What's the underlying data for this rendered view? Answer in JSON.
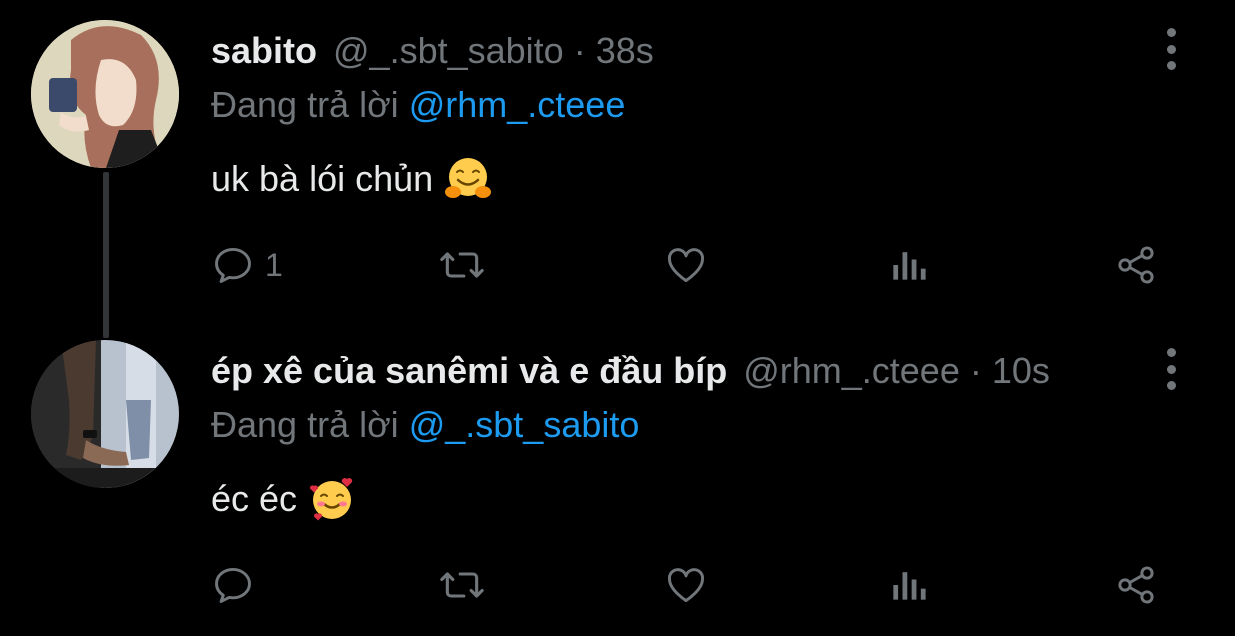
{
  "tweets": [
    {
      "name": "sabito",
      "handle": "@_.sbt_sabito",
      "separator": "·",
      "time": "38s",
      "replying_prefix": "Đang trả lời",
      "replying_to": "@rhm_.cteee",
      "text": "uk bà lói chủn",
      "emoji": "hugging-face",
      "reply_count": "1",
      "retweet_count": "",
      "like_count": ""
    },
    {
      "name": "ép xê của sanêmi và e đầu bíp",
      "handle": "@rhm_.cteee",
      "separator": "·",
      "time": "10s",
      "replying_prefix": "Đang trả lời",
      "replying_to": "@_.sbt_sabito",
      "text": "éc éc",
      "emoji": "smiling-face-with-hearts",
      "reply_count": "",
      "retweet_count": "",
      "like_count": ""
    }
  ],
  "colors": {
    "background": "#000000",
    "primary_text": "#e7e9ea",
    "secondary_text": "#71767b",
    "accent": "#1d9bf0",
    "thread_line": "#333639"
  },
  "icons": {
    "reply": "reply-bubble-icon",
    "retweet": "retweet-icon",
    "like": "heart-icon",
    "views": "analytics-bars-icon",
    "share": "share-icon",
    "more": "more-vertical-icon"
  }
}
